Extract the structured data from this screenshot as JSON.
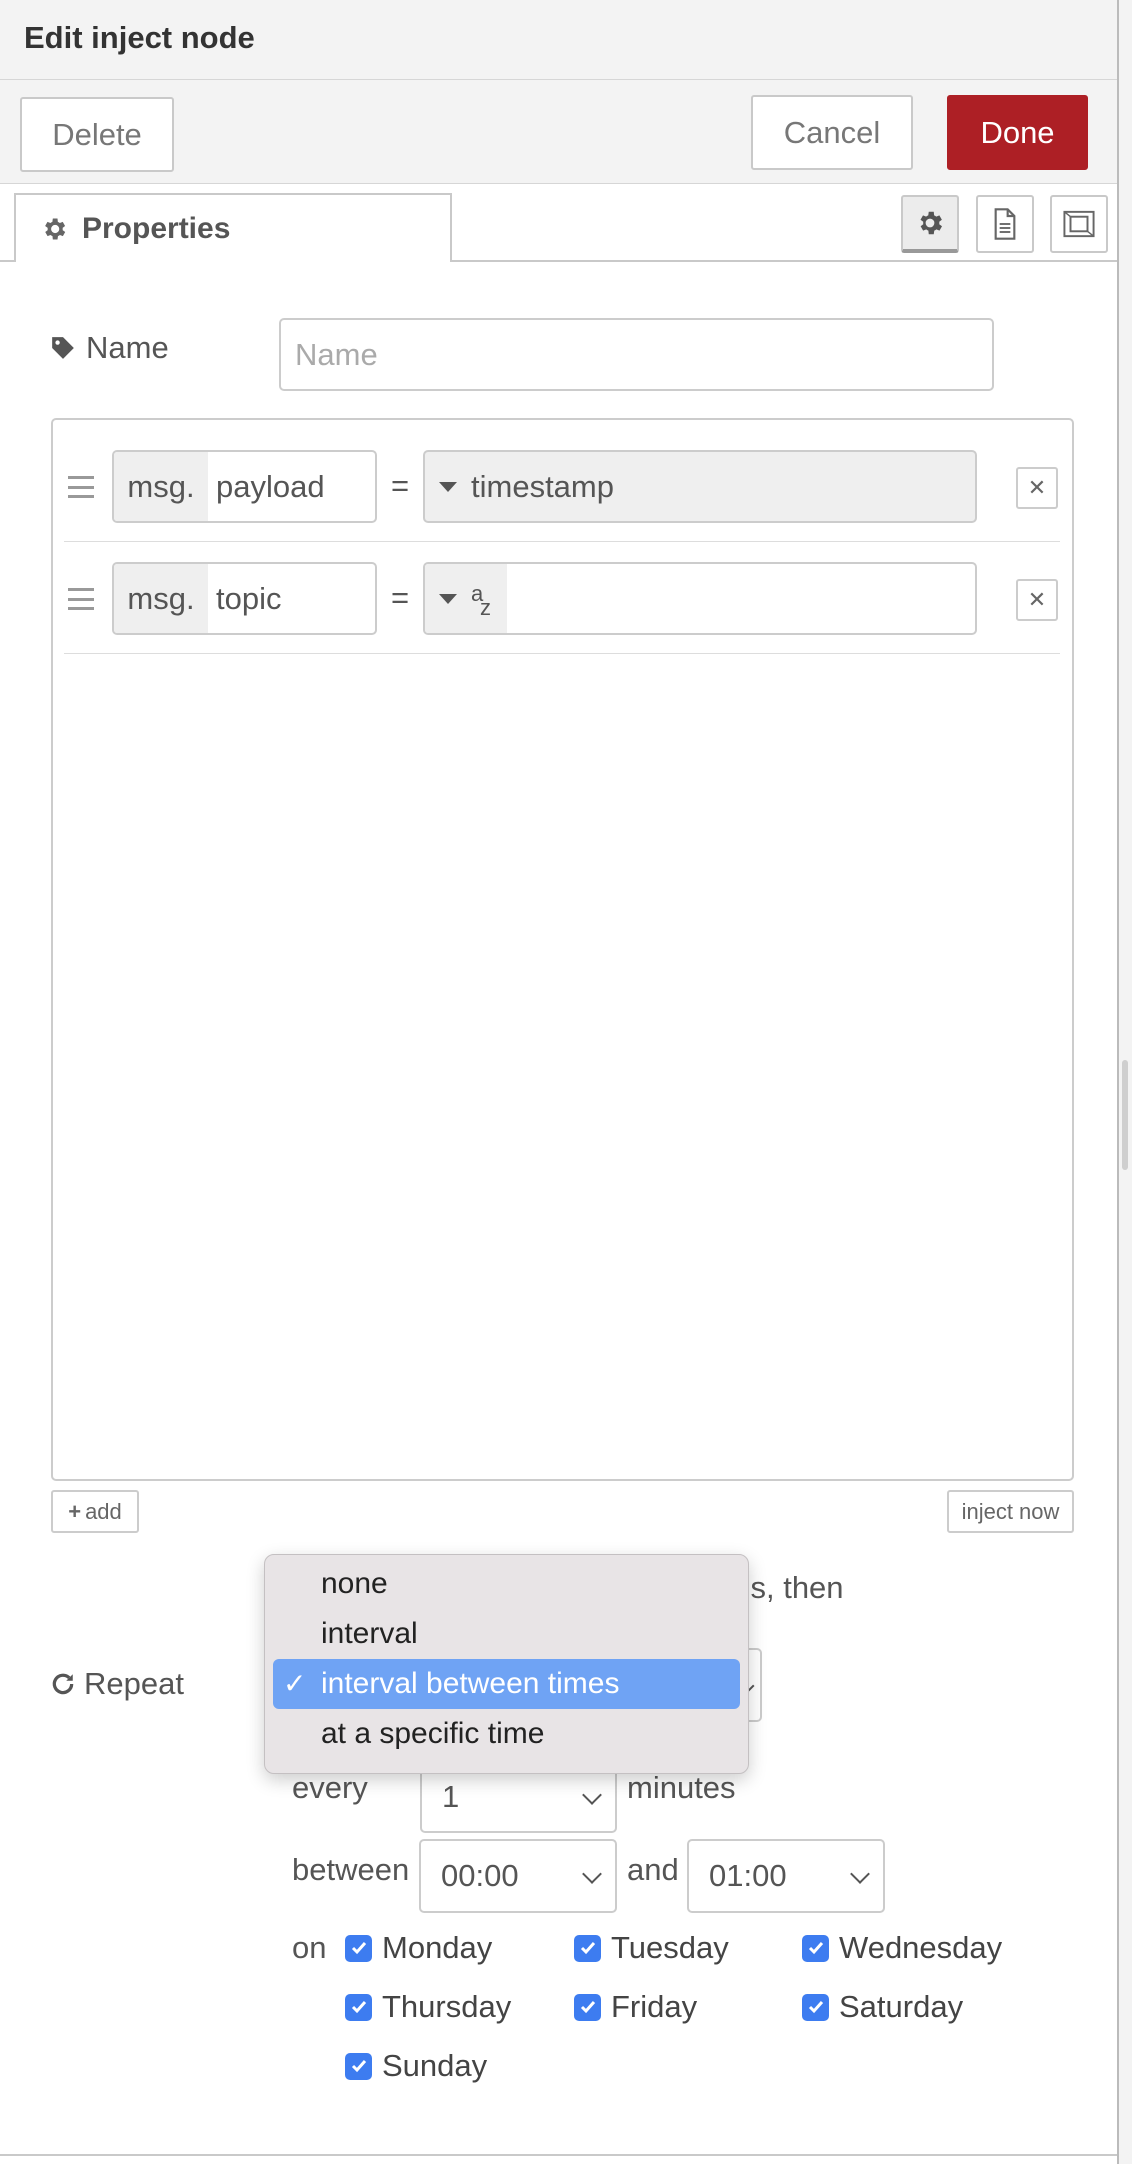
{
  "header": {
    "title": "Edit inject node"
  },
  "toolbar": {
    "delete_label": "Delete",
    "cancel_label": "Cancel",
    "done_label": "Done"
  },
  "tabs": {
    "properties_label": "Properties"
  },
  "form": {
    "name_label": "Name",
    "name_placeholder": "Name",
    "name_value": "",
    "properties": [
      {
        "prefix": "msg.",
        "property": "payload",
        "equals": "=",
        "type": "timestamp",
        "value": ""
      },
      {
        "prefix": "msg.",
        "property": "topic",
        "equals": "=",
        "type_icon_top": "a",
        "type_icon_bottom": "z",
        "value": ""
      }
    ],
    "add_label": "add",
    "inject_now_label": "inject now",
    "behind_text": "nds, then",
    "repeat_label": "Repeat",
    "repeat_options": [
      {
        "label": "none",
        "selected": false
      },
      {
        "label": "interval",
        "selected": false
      },
      {
        "label": "interval between times",
        "selected": true,
        "check": "✓"
      },
      {
        "label": "at a specific time",
        "selected": false
      }
    ],
    "every_label": "every",
    "every_value": "1",
    "minutes_label": "minutes",
    "between_label": "between",
    "between_from": "00:00",
    "and_label": "and",
    "between_to": "01:00",
    "on_label": "on",
    "days": [
      {
        "label": "Monday",
        "checked": true
      },
      {
        "label": "Tuesday",
        "checked": true
      },
      {
        "label": "Wednesday",
        "checked": true
      },
      {
        "label": "Thursday",
        "checked": true
      },
      {
        "label": "Friday",
        "checked": true
      },
      {
        "label": "Saturday",
        "checked": true
      },
      {
        "label": "Sunday",
        "checked": true
      }
    ]
  },
  "colors": {
    "done_bg": "#ad1f25",
    "selected_option": "#6fa3f4",
    "checkbox": "#3d7cf0"
  }
}
